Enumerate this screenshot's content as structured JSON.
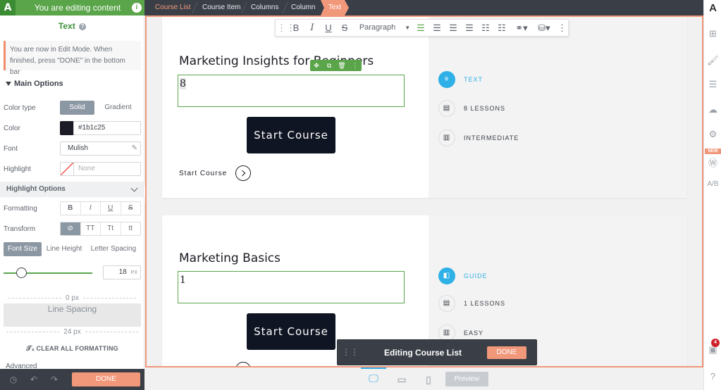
{
  "left_panel": {
    "header_title": "You are editing content",
    "logo": "A",
    "element_title": "Text",
    "edit_note": "You are now in Edit Mode. When finished, press \"DONE\" in the bottom bar",
    "main_options_label": "Main Options",
    "color_type": {
      "label": "Color type",
      "options": [
        "Solid",
        "Gradient"
      ],
      "selected": "Solid"
    },
    "color": {
      "label": "Color",
      "value": "#1b1c25"
    },
    "font": {
      "label": "Font",
      "value": "Mulish"
    },
    "highlight": {
      "label": "Highlight",
      "value": "None"
    },
    "highlight_options_label": "Highlight Options",
    "formatting": {
      "label": "Formatting",
      "buttons": [
        "B",
        "I",
        "U",
        "S"
      ]
    },
    "transform": {
      "label": "Transform",
      "buttons": [
        "⊘",
        "TT",
        "Tt",
        "tt"
      ]
    },
    "tabs": [
      "Font Size",
      "Line Height",
      "Letter Spacing"
    ],
    "font_size": {
      "value": "18",
      "unit": "PX",
      "fraction": 0.2
    },
    "spacer_top": "0 px",
    "line_spacing_label": "Line Spacing",
    "spacer_bottom": "24 px",
    "clear_formatting": "CLEAR ALL FORMATTING",
    "advanced": "Advanced",
    "done": "DONE"
  },
  "breadcrumb": [
    "Course List",
    "Course Item",
    "Columns",
    "Column",
    "Text"
  ],
  "format_toolbar": {
    "paragraph": "Paragraph"
  },
  "cards": [
    {
      "title": "Marketing Insights for Beginners",
      "number": "8",
      "button": "Start Course",
      "link": "Start Course",
      "meta": [
        {
          "label": "TEXT",
          "icon": "text-lines-icon",
          "highlight": true
        },
        {
          "label": "8 LESSONS",
          "icon": "document-icon",
          "highlight": false
        },
        {
          "label": "INTERMEDIATE",
          "icon": "bar-chart-icon",
          "highlight": false
        }
      ]
    },
    {
      "title": "Marketing Basics",
      "number": "1",
      "button": "Start Course",
      "meta": [
        {
          "label": "GUIDE",
          "icon": "book-icon",
          "highlight": true
        },
        {
          "label": "1 LESSONS",
          "icon": "document-icon",
          "highlight": false
        },
        {
          "label": "EASY",
          "icon": "bar-chart-icon",
          "highlight": false
        }
      ]
    }
  ],
  "editing_bar": {
    "label": "Editing Course List",
    "done": "DONE"
  },
  "bottom_bar": {
    "preview": "Preview"
  },
  "rail": {
    "new_badge": "NEW",
    "notification_count": "4",
    "logo": "A"
  },
  "colors": {
    "accent": "#f1977a",
    "green": "#5aa54a",
    "dark": "#3a3f47",
    "blue": "#2fb0e6"
  }
}
